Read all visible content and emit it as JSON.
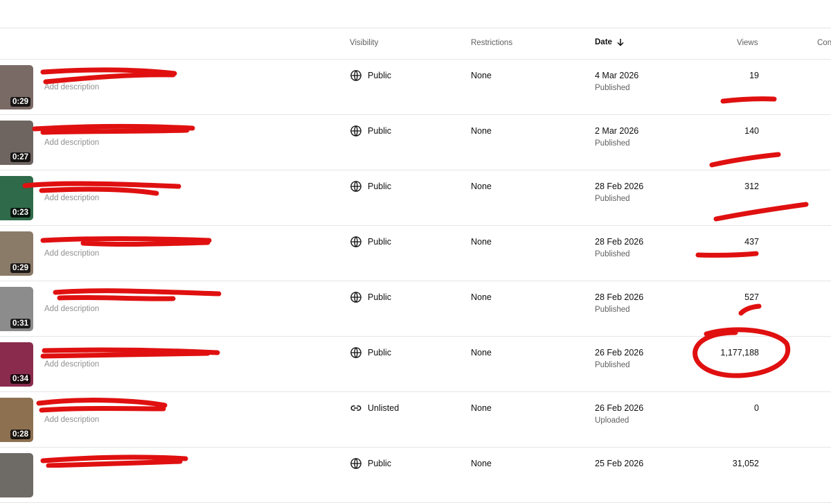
{
  "columns": {
    "visibility": "Visibility",
    "restrictions": "Restrictions",
    "date": "Date",
    "views": "Views",
    "comments_partial": "Con"
  },
  "rows": [
    {
      "duration": "0:29",
      "description": "Add description",
      "visibility": "Public",
      "visibility_icon": "globe-icon",
      "restrictions": "None",
      "date": "4 Mar 2026",
      "status": "Published",
      "views": "19",
      "thumb_color": "#7a6a66"
    },
    {
      "duration": "0:27",
      "description": "Add description",
      "visibility": "Public",
      "visibility_icon": "globe-icon",
      "restrictions": "None",
      "date": "2 Mar 2026",
      "status": "Published",
      "views": "140",
      "thumb_color": "#6e6460"
    },
    {
      "duration": "0:23",
      "description": "Add description",
      "visibility": "Public",
      "visibility_icon": "globe-icon",
      "restrictions": "None",
      "date": "28 Feb 2026",
      "status": "Published",
      "views": "312",
      "thumb_color": "#2f6b4a"
    },
    {
      "duration": "0:29",
      "description": "Add description",
      "visibility": "Public",
      "visibility_icon": "globe-icon",
      "restrictions": "None",
      "date": "28 Feb 2026",
      "status": "Published",
      "views": "437",
      "thumb_color": "#8a7a68"
    },
    {
      "duration": "0:31",
      "description": "Add description",
      "visibility": "Public",
      "visibility_icon": "globe-icon",
      "restrictions": "None",
      "date": "28 Feb 2026",
      "status": "Published",
      "views": "527",
      "thumb_color": "#8c8c8c"
    },
    {
      "duration": "0:34",
      "description": "Add description",
      "visibility": "Public",
      "visibility_icon": "globe-icon",
      "restrictions": "None",
      "date": "26 Feb 2026",
      "status": "Published",
      "views": "1,177,188",
      "thumb_color": "#8a2b4e"
    },
    {
      "duration": "0:28",
      "description": "Add description",
      "visibility": "Unlisted",
      "visibility_icon": "link-icon",
      "restrictions": "None",
      "date": "26 Feb 2026",
      "status": "Uploaded",
      "views": "0",
      "thumb_color": "#8c7050"
    },
    {
      "duration": "",
      "description": "",
      "visibility": "Public",
      "visibility_icon": "globe-icon",
      "restrictions": "None",
      "date": "25 Feb 2026",
      "status": "",
      "views": "31,052",
      "thumb_color": "#6e6a66"
    }
  ],
  "annotation_color": "#e01010"
}
